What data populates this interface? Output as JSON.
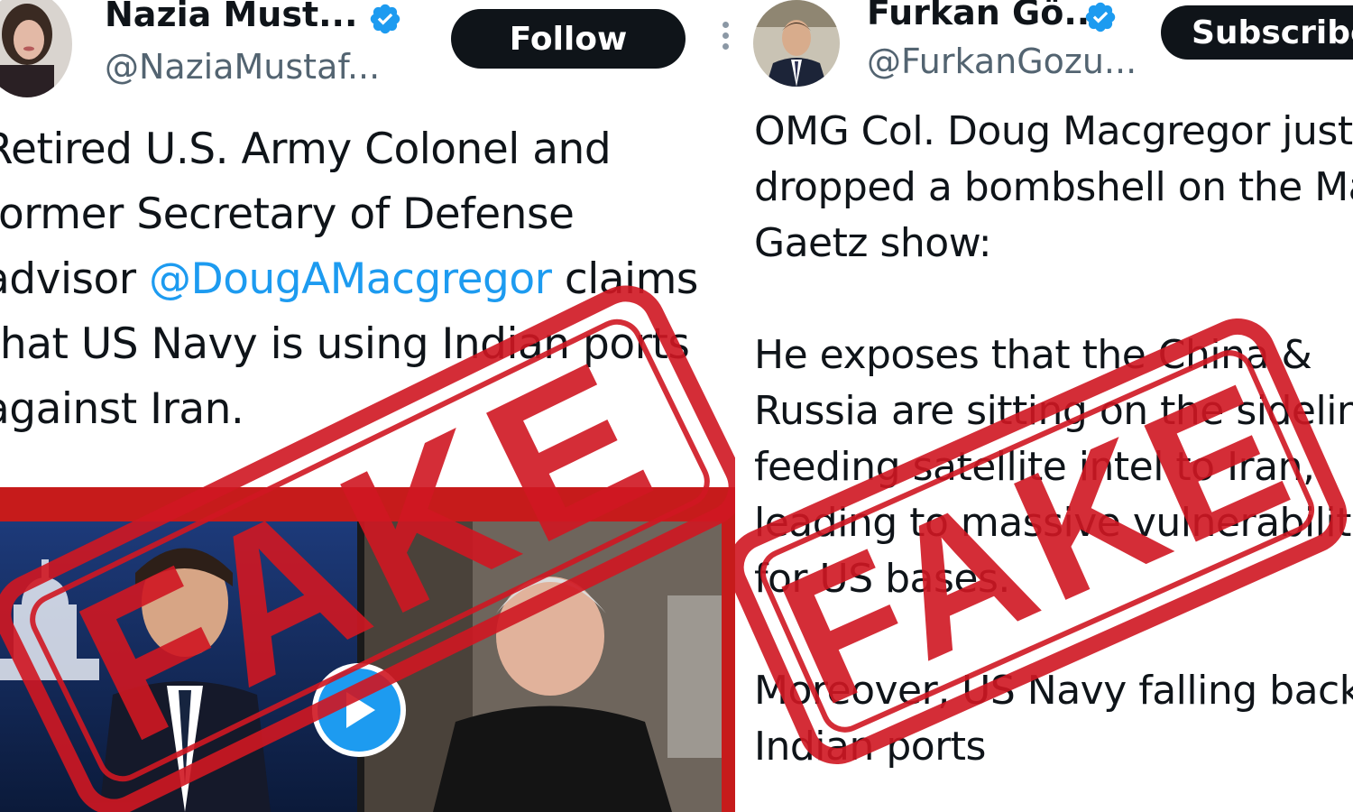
{
  "left_tweet": {
    "author_name": "Nazia Must...",
    "author_handle": "@NaziaMustaf...",
    "follow_label": "Follow",
    "verified_icon": "verified-badge-icon",
    "text_lines": [
      "Retired U.S. Army Colonel and",
      "former Secretary of Defense",
      "advisor",
      "@DougAMacgregor",
      "claims",
      "that US Navy is using Indian ports",
      "against Iran."
    ],
    "media": {
      "play_icon": "play-icon"
    },
    "stamp_text": "FAKE"
  },
  "right_tweet": {
    "author_name": "Furkan Gö...",
    "author_handle": "@FurkanGozu...",
    "subscribe_label": "Subscribe",
    "verified_icon": "verified-badge-icon",
    "text_lines": [
      "OMG Col. Doug Macgregor just",
      "dropped a bombshell on the Matt",
      "Gaetz show:",
      "",
      "He exposes that the China &",
      "Russia are sitting on the sidelines",
      "feeding satellite intel to Iran,",
      "leading to massive vulnerabilities",
      "for US bases.",
      "",
      "Moreover, US Navy falling back to",
      "Indian ports"
    ],
    "stamp_text": "FAKE"
  },
  "colors": {
    "text": "#0f1419",
    "handle": "#536471",
    "mention": "#1d9bf0",
    "verified": "#1d9bf0",
    "pill_bg": "#0f1419",
    "stamp_red": "#d01722"
  }
}
